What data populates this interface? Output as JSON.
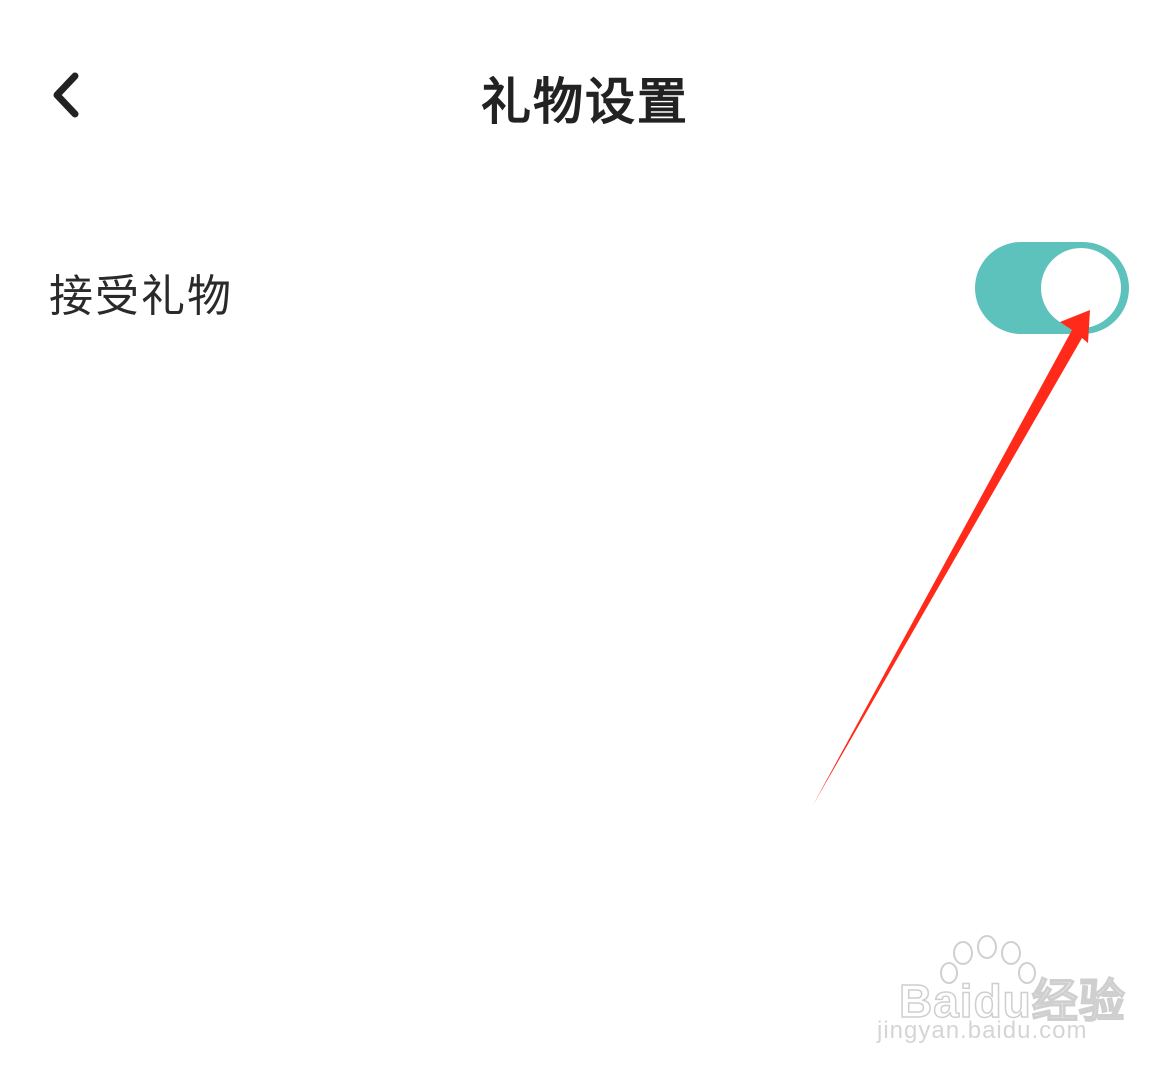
{
  "header": {
    "back_icon": "chevron-left-icon",
    "title": "礼物设置"
  },
  "settings": [
    {
      "label": "接受礼物",
      "toggle_on": true,
      "toggle_color": "#5ec2bc"
    }
  ],
  "annotation": {
    "arrow_color": "#ff2a1a"
  },
  "watermark": {
    "logo_text": "Baidu经验",
    "url": "jingyan.baidu.com"
  }
}
